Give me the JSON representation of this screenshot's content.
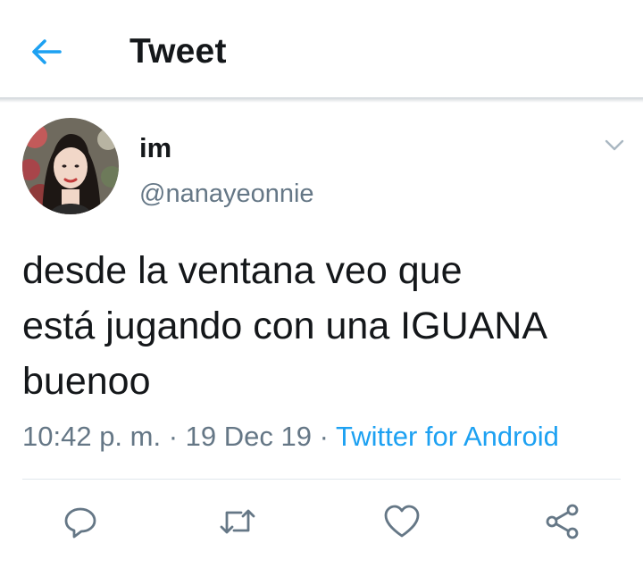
{
  "header": {
    "title": "Tweet",
    "back_icon": "arrow-left-icon",
    "accent_color": "#1da1f2"
  },
  "tweet": {
    "display_name": "im",
    "handle": "@nanayeonnie",
    "text_lines": [
      "desde la ventana veo que",
      "está jugando con una IGUANA",
      "buenoo"
    ],
    "time": "10:42 p. m.",
    "date": "19 Dec 19",
    "separator": "·",
    "source": "Twitter for Android",
    "source_color": "#1da1f2"
  },
  "actions": [
    {
      "name": "reply",
      "icon": "reply-icon"
    },
    {
      "name": "retweet",
      "icon": "retweet-icon"
    },
    {
      "name": "like",
      "icon": "heart-icon"
    },
    {
      "name": "share",
      "icon": "share-icon"
    }
  ]
}
